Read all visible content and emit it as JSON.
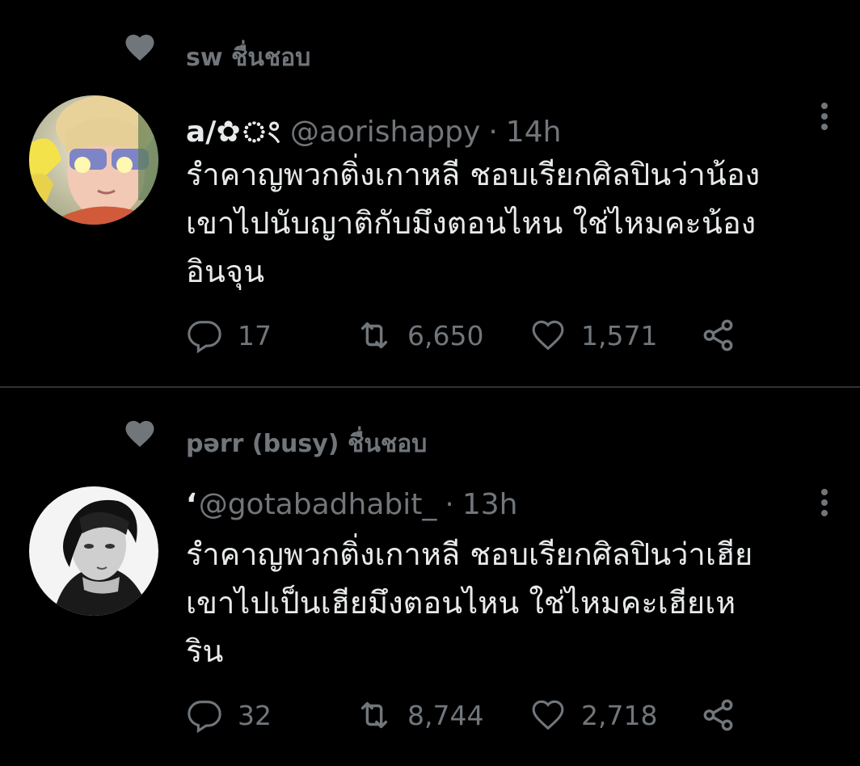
{
  "tweets": [
    {
      "liked_by": "sw ชื่นชอบ",
      "display_name": "a/✿ং",
      "handle": "@aorishappy",
      "separator": "·",
      "time": "14h",
      "text_lines": [
        "รำคาญพวกติ่งเกาหลี ชอบเรียกศิลปินว่าน้อง",
        "เขาไปนับญาติกับมึงตอนไหน ใช่ไหมคะน้อง",
        "อินจุน"
      ],
      "replies": "17",
      "retweets": "6,650",
      "likes": "1,571"
    },
    {
      "liked_by": "pərr (busy) ชื่นชอบ",
      "display_name": "ʻ",
      "handle": "@gotabadhabit_",
      "separator": "·",
      "time": "13h",
      "text_lines": [
        "รำคาญพวกติ่งเกาหลี ชอบเรียกศิลปินว่าเฮีย",
        "เขาไปเป็นเฮียมึงตอนไหน ใช่ไหมคะเฮียเห",
        "ริน"
      ],
      "replies": "32",
      "retweets": "8,744",
      "likes": "2,718"
    }
  ],
  "colors": {
    "background": "#000000",
    "text": "#e7e9ea",
    "muted": "#71767b",
    "divider": "#2f3336"
  },
  "icons": [
    "heart-icon",
    "reply-icon",
    "retweet-icon",
    "like-icon",
    "share-icon",
    "more-icon"
  ]
}
